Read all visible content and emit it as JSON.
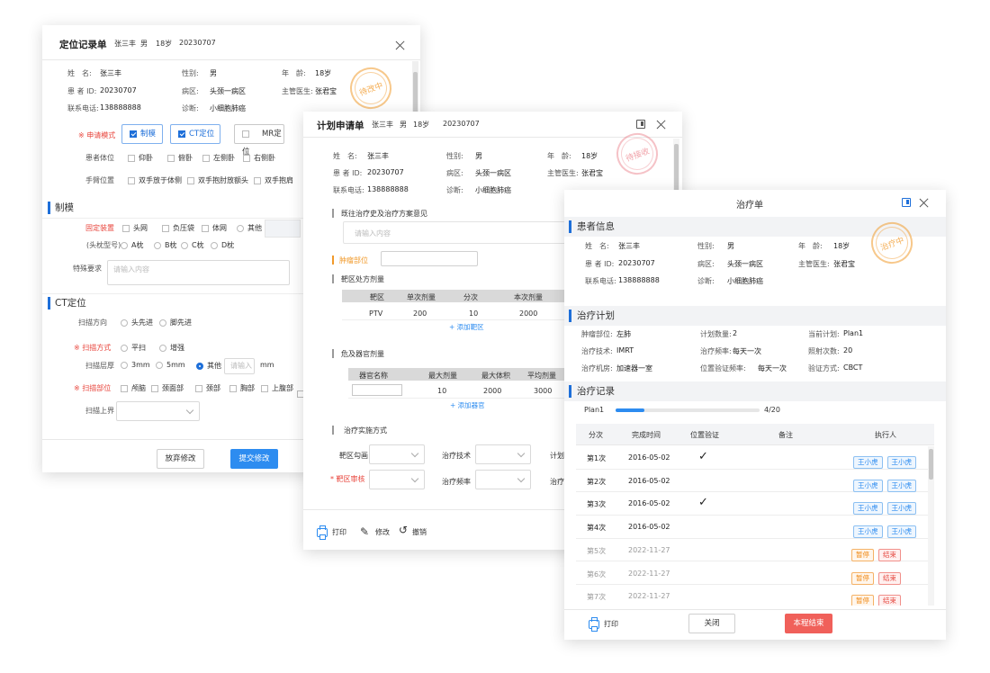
{
  "w1": {
    "title": "定位记录单",
    "name": "张三丰",
    "gender": "男",
    "age": "18岁",
    "id": "20230707",
    "info": [
      {
        "label": "姓　名:",
        "value": "张三丰"
      },
      {
        "label": "性别:",
        "value": "男"
      },
      {
        "label": "年　龄:",
        "value": "18岁"
      },
      {
        "label": "患 者 ID:",
        "value": "20230707"
      },
      {
        "label": "病区:",
        "value": "头颈一病区"
      },
      {
        "label": "主管医生:",
        "value": "张君宝"
      },
      {
        "label": "联系电话:",
        "value": "138888888"
      },
      {
        "label": "诊断:",
        "value": "小细胞肺癌"
      }
    ],
    "stamp": "待改中",
    "apply_mode_label": "※ 申请模式",
    "modes": [
      "制模",
      "CT定位",
      "MR定位"
    ],
    "position_label": "患者体位",
    "positions": [
      "仰卧",
      "俯卧",
      "左侧卧",
      "右侧卧"
    ],
    "arm_label": "手臂位置",
    "arms": [
      "双手放于体侧",
      "双手抱肘放额头",
      "双手抱肩"
    ],
    "sec_mold": "制模",
    "fixture_label": "固定装置",
    "fixtures": [
      "头网",
      "负压袋",
      "体网",
      "其他"
    ],
    "pillow_label": "(头枕型号)",
    "pillows": [
      "A枕",
      "B枕",
      "C枕",
      "D枕"
    ],
    "special_label": "特殊要求",
    "special_placeholder": "请输入内容",
    "sec_ct": "CT定位",
    "scan_dir_label": "扫描方向",
    "scan_dirs": [
      "头先进",
      "脚先进"
    ],
    "scan_mode_label": "※ 扫描方式",
    "scan_modes": [
      "平扫",
      "增强"
    ],
    "slice_label": "扫描层厚",
    "slices": [
      "3mm",
      "5mm",
      "其他"
    ],
    "slice_placeholder": "请输入",
    "slice_unit": "mm",
    "scan_part_label": "※ 扫描部位",
    "scan_parts": [
      "颅脑",
      "颈面部",
      "颈部",
      "胸部",
      "上腹部"
    ],
    "scan_upper_label": "扫描上界",
    "btn_discard": "放弃修改",
    "btn_submit": "提交修改"
  },
  "w2": {
    "title": "计划申请单",
    "name": "张三丰",
    "gender": "男",
    "age": "18岁",
    "id": "20230707",
    "info": [
      {
        "label": "姓　名:",
        "value": "张三丰"
      },
      {
        "label": "性别:",
        "value": "男"
      },
      {
        "label": "年　龄:",
        "value": "18岁"
      },
      {
        "label": "患 者 ID:",
        "value": "20230707"
      },
      {
        "label": "病区:",
        "value": "头颈一病区"
      },
      {
        "label": "主管医生:",
        "value": "张君宝"
      },
      {
        "label": "联系电话:",
        "value": "138888888"
      },
      {
        "label": "诊断:",
        "value": "小细胞肺癌"
      }
    ],
    "stamp": "待接收",
    "history_label": "既往治疗史及治疗方案意见",
    "history_placeholder": "请输入内容",
    "tumor_label": "肿瘤部位",
    "target_label": "靶区处方剂量",
    "target_headers": [
      "靶区",
      "单次剂量",
      "分次",
      "本次剂量"
    ],
    "target_row": [
      "PTV",
      "200",
      "10",
      "2000"
    ],
    "add_target": "+ 添加靶区",
    "organ_label": "危及器官剂量",
    "organ_headers": [
      "器官名称",
      "最大剂量",
      "最大体积",
      "平均剂量"
    ],
    "organ_row": [
      "",
      "10",
      "2000",
      "3000"
    ],
    "add_organ": "+ 添加器官",
    "impl_label": "治疗实施方式",
    "f_contour": "靶区勾画",
    "f_tech": "治疗技术",
    "f_plan": "计划",
    "f_review": "* 靶区审核",
    "f_freq": "治疗频率",
    "f_machine": "治疗",
    "print": "打印",
    "edit": "修改",
    "revoke": "撤销"
  },
  "w3": {
    "title": "治疗单",
    "sec_patient": "患者信息",
    "info": [
      {
        "label": "姓　名:",
        "value": "张三丰"
      },
      {
        "label": "性别:",
        "value": "男"
      },
      {
        "label": "年　龄:",
        "value": "18岁"
      },
      {
        "label": "患 者 ID:",
        "value": "20230707"
      },
      {
        "label": "病区:",
        "value": "头颈一病区"
      },
      {
        "label": "主管医生:",
        "value": "张君宝"
      },
      {
        "label": "联系电话:",
        "value": "138888888"
      },
      {
        "label": "诊断:",
        "value": "小细胞肺癌"
      }
    ],
    "stamp": "治疗中",
    "sec_plan": "治疗计划",
    "plan": [
      {
        "label": "肿瘤部位:",
        "value": "左肺"
      },
      {
        "label": "计划数量:",
        "value": "2"
      },
      {
        "label": "当前计划:",
        "value": "Plan1"
      },
      {
        "label": "治疗技术:",
        "value": "IMRT"
      },
      {
        "label": "治疗频率:",
        "value": "每天一次"
      },
      {
        "label": "照射次数:",
        "value": "20"
      },
      {
        "label": "治疗机房:",
        "value": "加速器一室"
      },
      {
        "label": "位置验证频率:",
        "value": "每天一次"
      },
      {
        "label": "验证方式:",
        "value": "CBCT"
      }
    ],
    "sec_record": "治疗记录",
    "progress_name": "Plan1",
    "progress": 0.2,
    "progress_text": "4/20",
    "headers": [
      "分次",
      "完成时间",
      "位置验证",
      "备注",
      "执行人"
    ],
    "rows": [
      {
        "n": "第1次",
        "date": "2016-05-02",
        "check": "✓",
        "note": "",
        "tags": [
          "王小虎",
          "王小虎"
        ],
        "kind": "done"
      },
      {
        "n": "第2次",
        "date": "2016-05-02",
        "check": "",
        "note": "",
        "tags": [
          "王小虎",
          "王小虎"
        ],
        "kind": "done"
      },
      {
        "n": "第3次",
        "date": "2016-05-02",
        "check": "✓",
        "note": "",
        "tags": [
          "王小虎",
          "王小虎"
        ],
        "kind": "done"
      },
      {
        "n": "第4次",
        "date": "2016-05-02",
        "check": "",
        "note": "",
        "tags": [
          "王小虎",
          "王小虎"
        ],
        "kind": "done"
      },
      {
        "n": "第5次",
        "date": "2022-11-27",
        "check": "",
        "note": "",
        "tags": [
          "暂停",
          "结束"
        ],
        "kind": "pending"
      },
      {
        "n": "第6次",
        "date": "2022-11-27",
        "check": "",
        "note": "",
        "tags": [
          "暂停",
          "结束"
        ],
        "kind": "pending"
      },
      {
        "n": "第7次",
        "date": "2022-11-27",
        "check": "",
        "note": "",
        "tags": [
          "暂停",
          "结束"
        ],
        "kind": "pending"
      }
    ],
    "print": "打印",
    "close": "关闭",
    "end": "本程结束"
  }
}
